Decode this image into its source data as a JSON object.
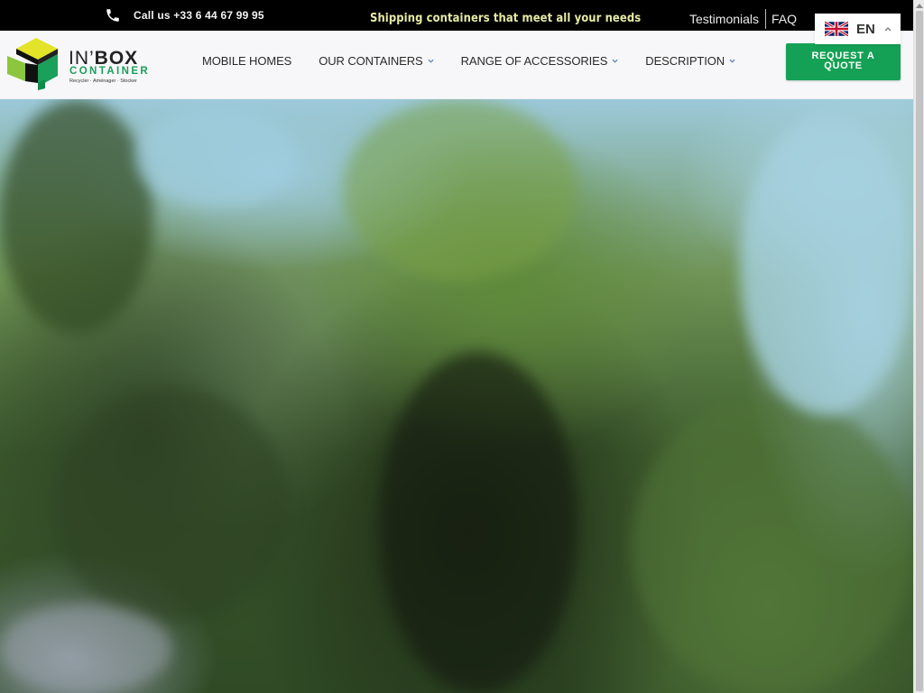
{
  "topbar": {
    "phone_icon": "phone-icon",
    "phone_text": "Call us +33 6 44 67 99 95",
    "tagline": "Shipping containers that meet all your needs",
    "links": [
      "Testimonials",
      "FAQ"
    ]
  },
  "logo": {
    "title_light": "IN’",
    "title_bold": "BOX",
    "subtitle": "CONTAINER",
    "tagline": "Recycler · Aménager · Stocker"
  },
  "nav": {
    "items": [
      {
        "label": "MOBILE HOMES",
        "has_dropdown": false
      },
      {
        "label": "OUR CONTAINERS",
        "has_dropdown": true
      },
      {
        "label": "RANGE OF ACCESSORIES",
        "has_dropdown": true
      },
      {
        "label": "DESCRIPTION",
        "has_dropdown": true
      }
    ]
  },
  "cta": {
    "label_line1": "REQUEST A",
    "label_line2": "QUOTE"
  },
  "language": {
    "code": "EN",
    "flag_icon": "uk-flag-icon",
    "caret_icon": "chevron-up-icon"
  },
  "hero": {
    "image": "blurred-trees-sky-photo"
  },
  "colors": {
    "brand_green": "#15a155",
    "topbar_bg": "#000000",
    "tagline_color": "#e7eaa3",
    "logo_yellow": "#e3e328",
    "chevron_blue": "#5b7fb8"
  }
}
